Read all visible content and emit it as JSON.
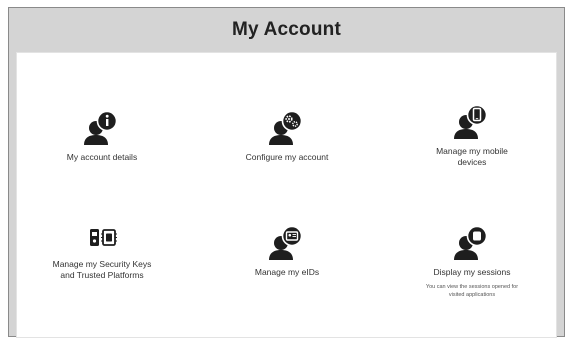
{
  "header": {
    "title": "My Account"
  },
  "tiles": [
    {
      "icon": "user-info-icon",
      "label": "My account details"
    },
    {
      "icon": "user-settings-icon",
      "label": "Configure my account"
    },
    {
      "icon": "user-mobile-icon",
      "label": "Manage my mobile devices"
    },
    {
      "icon": "security-keys-icon",
      "label": "Manage my Security Keys and Trusted Platforms"
    },
    {
      "icon": "user-eid-icon",
      "label": "Manage my eIDs"
    },
    {
      "icon": "user-sessions-icon",
      "label": "Display my sessions",
      "description": "You can view the sessions opened for visited applications"
    }
  ],
  "colors": {
    "icon": "#1e1e1e",
    "header_bg": "#d4d4d4",
    "panel_bg": "#ffffff"
  }
}
